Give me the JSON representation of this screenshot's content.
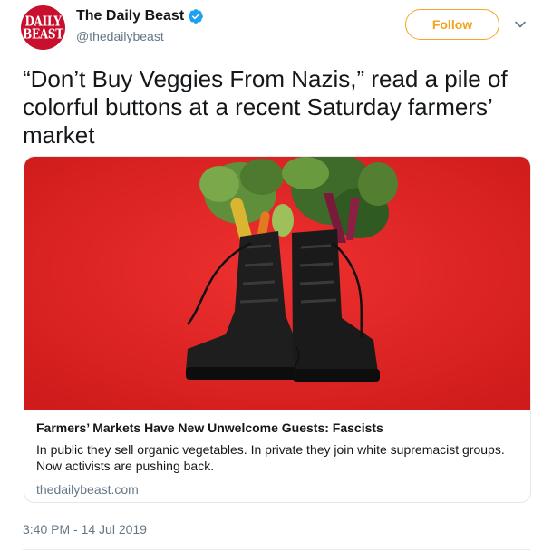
{
  "author": {
    "display_name": "The Daily Beast",
    "handle": "@thedailybeast",
    "avatar_text_line1": "DAILY",
    "avatar_text_line2": "BEAST",
    "verified": true
  },
  "header": {
    "follow_label": "Follow"
  },
  "tweet": {
    "text": "“Don’t Buy Veggies From Nazis,” read a pile of colorful buttons at a recent Saturday farmers’ market",
    "timestamp": "3:40 PM - 14 Jul 2019"
  },
  "card": {
    "title": "Farmers’ Markets Have New Unwelcome Guests: Fascists",
    "description": "In public they sell organic vegetables. In private they join white supremacist groups. Now activists are pushing back.",
    "domain": "thedailybeast.com",
    "image_background_color": "#dd2222"
  },
  "colors": {
    "brand_red": "#c8102e",
    "follow_accent": "#f5a623",
    "verified_blue": "#1da1f2",
    "muted_text": "#657786"
  },
  "icons": {
    "verified": "verified-badge-icon",
    "caret": "chevron-down-icon"
  }
}
